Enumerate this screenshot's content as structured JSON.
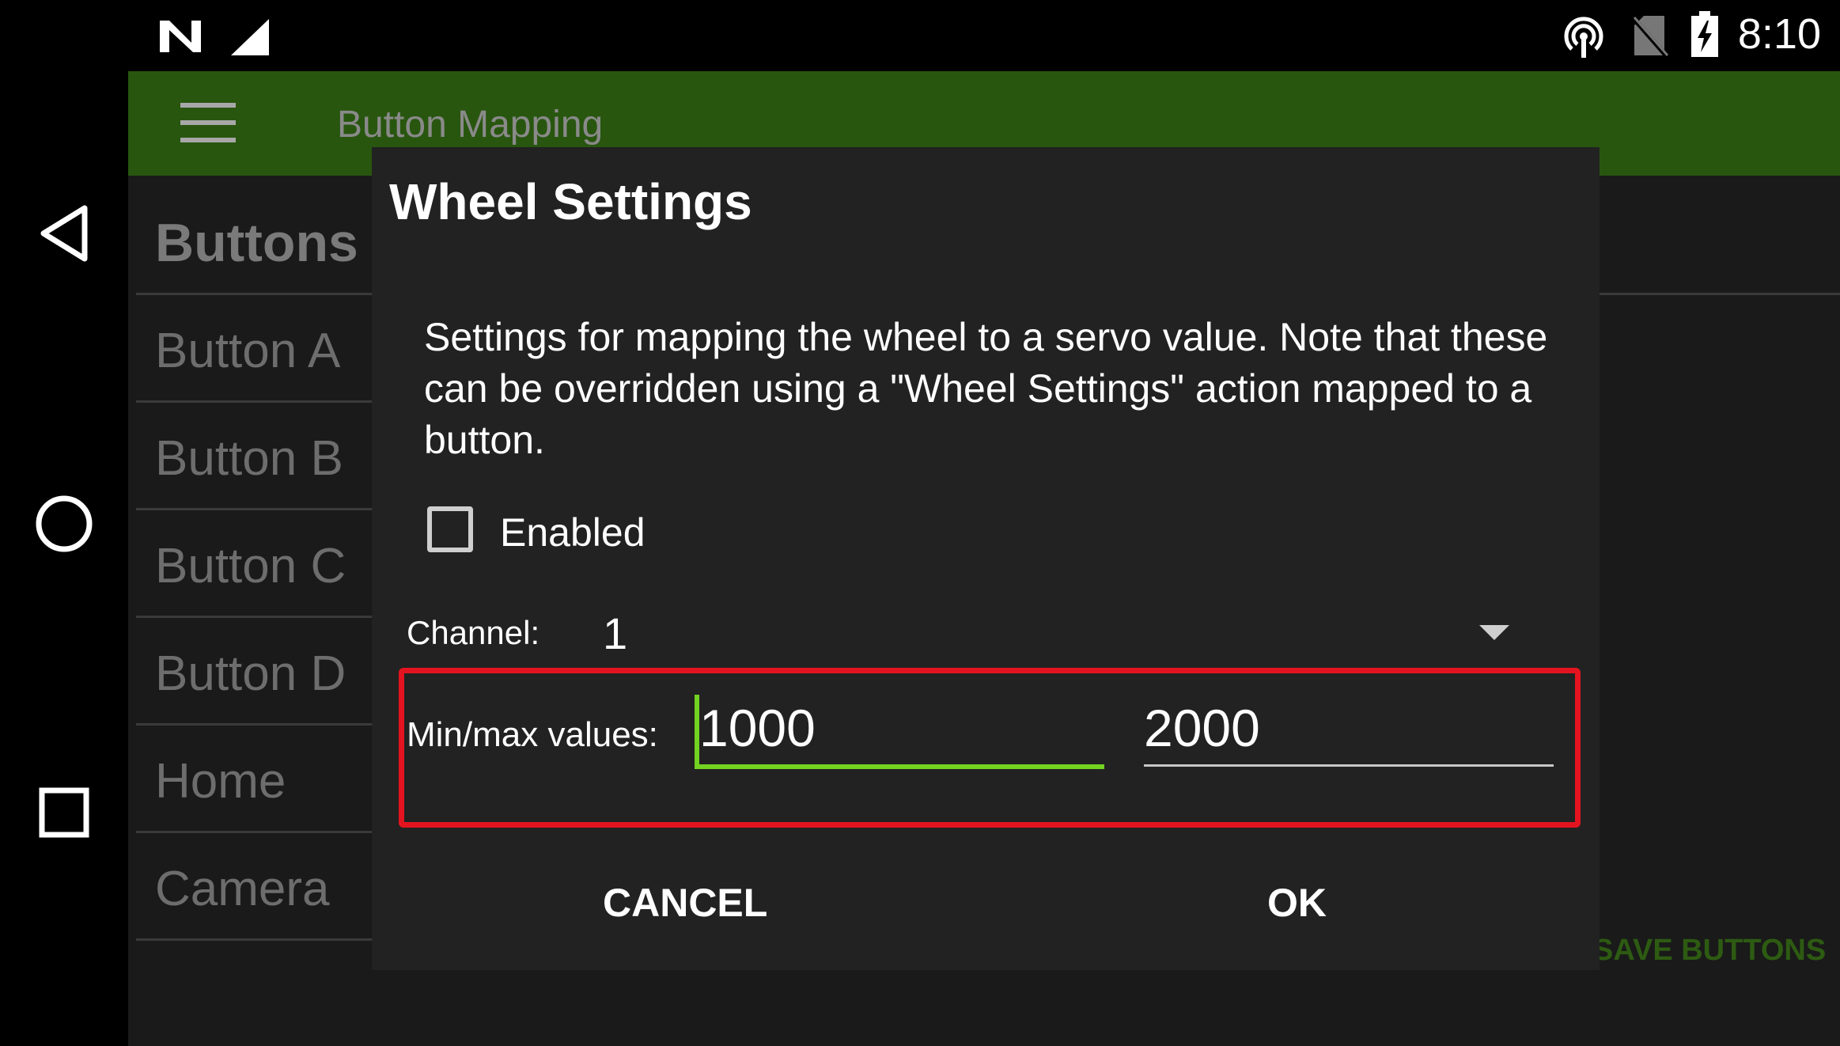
{
  "status_bar": {
    "time": "8:10",
    "icons": [
      "n-notification-icon",
      "cell-signal-icon",
      "hotspot-icon",
      "no-sim-icon",
      "battery-charging-icon"
    ]
  },
  "nav_bar": {
    "icons": [
      "back-icon",
      "home-icon",
      "recents-icon"
    ]
  },
  "app": {
    "title": "Button Mapping",
    "toolbar_color": "#28560f",
    "list": {
      "header": "Buttons",
      "items": [
        "Button A",
        "Button B",
        "Button C",
        "Button D",
        "Home",
        "Camera"
      ]
    },
    "save_buttons_label": "SAVE BUTTONS"
  },
  "dialog": {
    "title": "Wheel Settings",
    "message": "Settings for mapping the wheel to a servo value. Note that these can be overridden using a \"Wheel Settings\" action mapped to a button.",
    "enabled_label": "Enabled",
    "enabled_checked": false,
    "channel_label": "Channel:",
    "channel_value": "1",
    "minmax_label": "Min/max values:",
    "min_value": "1000",
    "max_value": "2000",
    "cancel_label": "CANCEL",
    "ok_label": "OK",
    "accent_color": "#72d321",
    "highlight_color": "#e3141f"
  }
}
